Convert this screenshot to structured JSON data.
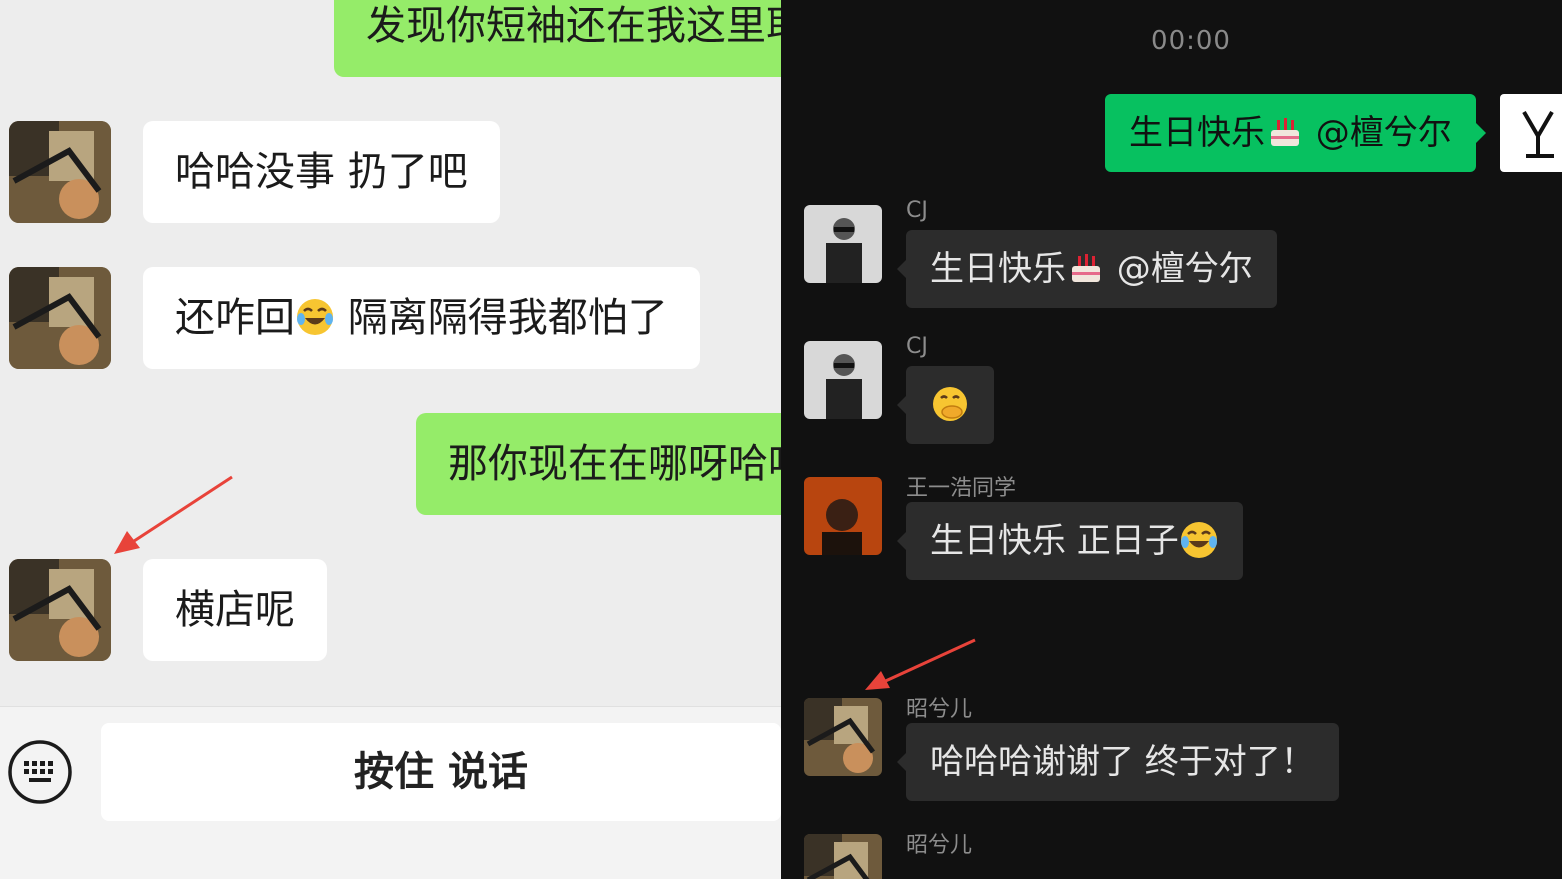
{
  "left_chat": {
    "messages": [
      {
        "side": "me",
        "text": "发现你短袖还在我这里耶"
      },
      {
        "side": "other",
        "text": "哈哈没事 扔了吧"
      },
      {
        "side": "other",
        "text_before": "还咋回",
        "text_after": " 隔离隔得我都怕了",
        "emoji": "face-with-tears-of-joy"
      },
      {
        "side": "me",
        "text": "那你现在在哪呀哈哈"
      },
      {
        "side": "other",
        "text": "横店呢"
      }
    ],
    "input_bar": {
      "hold_to_talk": "按住 说话",
      "keyboard_icon": "keyboard-icon"
    }
  },
  "right_chat": {
    "timestamp": "00:00",
    "my_message": {
      "text_before": "生日快乐",
      "emoji": "birthday-cake",
      "text_after": " @檀兮尔"
    },
    "messages": [
      {
        "name": "CJ",
        "text_before": "生日快乐",
        "emoji": "birthday-cake",
        "text_after": " @檀兮尔"
      },
      {
        "name": "CJ",
        "emoji": "hand-over-mouth"
      },
      {
        "name": "王一浩同学",
        "text_before": "生日快乐 正日子",
        "emoji": "face-with-tears-of-joy",
        "text_after": ""
      },
      {
        "name": "昭兮儿",
        "text": "哈哈哈谢谢了 终于对了！"
      },
      {
        "name": "昭兮儿",
        "text": ""
      }
    ]
  },
  "colors": {
    "light_bg": "#ededed",
    "light_me_bubble": "#95ec69",
    "dark_bg": "#111111",
    "dark_bubble": "#2c2c2c",
    "dark_me_bubble": "#07c160",
    "arrow": "#e8433a"
  }
}
